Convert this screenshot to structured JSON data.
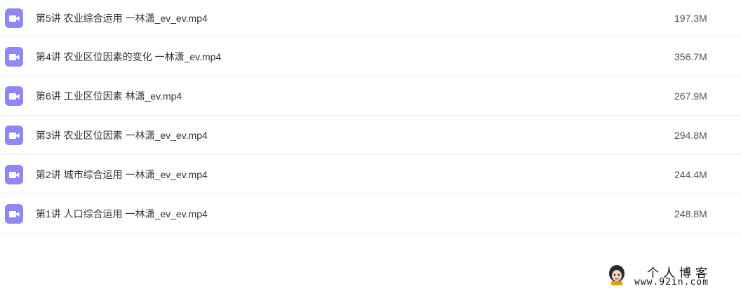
{
  "files": [
    {
      "name": "第5讲 农业综合运用 一林潇_ev_ev.mp4",
      "size": "197.3M",
      "icon": "video-file-icon"
    },
    {
      "name": "第4讲 农业区位因素的变化 一林潇_ev.mp4",
      "size": "356.7M",
      "icon": "video-file-icon"
    },
    {
      "name": "第6讲 工业区位因素 林潇_ev.mp4",
      "size": "267.9M",
      "icon": "video-file-icon"
    },
    {
      "name": "第3讲 农业区位因素 一林潇_ev_ev.mp4",
      "size": "294.8M",
      "icon": "video-file-icon"
    },
    {
      "name": "第2讲 城市综合运用 一林潇_ev_ev.mp4",
      "size": "244.4M",
      "icon": "video-file-icon"
    },
    {
      "name": "第1讲 人口综合运用 一林潇_ev_ev.mp4",
      "size": "248.8M",
      "icon": "video-file-icon"
    }
  ],
  "colors": {
    "icon_bg": "#8f87f5",
    "divider": "#eeeeee"
  },
  "watermark": {
    "title": "个人博客",
    "url": "www.92in.com"
  }
}
